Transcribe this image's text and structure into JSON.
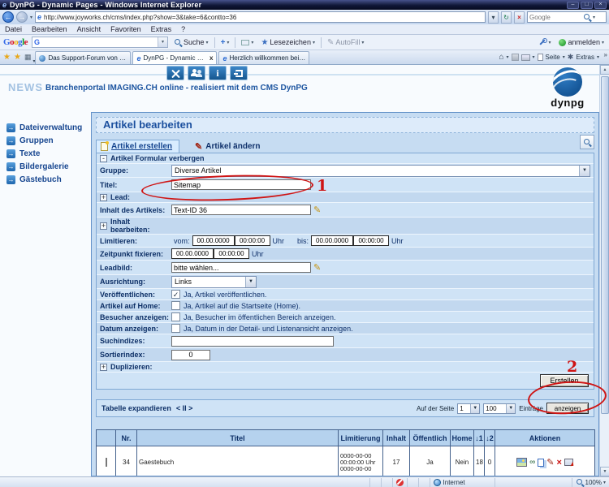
{
  "colors": {
    "accent_blue": "#1b5fa8",
    "panel_blue": "#c6dcf2",
    "link_navy": "#16458f",
    "annotation_red": "#cf1414",
    "brand_light_blue": "#a3c2e2",
    "table_header_blue": "#b5d2ee"
  },
  "icons": {
    "ie_logo": "e",
    "back": "←",
    "forward": "→",
    "refresh": "↻",
    "stop": "×",
    "dropdown": "▾",
    "select_arrow": "▼",
    "favorites_star": "★",
    "add_star": "★",
    "plus": "+",
    "quicktabs": "▦",
    "home": "⌂",
    "gear": "✱",
    "overflow": "»",
    "info": "i",
    "sidebar_arrow": "→",
    "collapse": "-",
    "expand": "+",
    "check": "✓",
    "pencil": "✎",
    "link": "∞",
    "delete": "×",
    "scroll_up": "▲",
    "scroll_down": "▼",
    "win_min": "–",
    "win_max": "□",
    "win_close": "×",
    "tab_close": "x"
  },
  "titlebar": {
    "title": "DynPG - Dynamic Pages - Windows Internet Explorer"
  },
  "addressbar": {
    "url": "http://www.joyworks.ch/cms/index.php?show=3&take=6&contto=36",
    "search_placeholder": "Google"
  },
  "menubar": {
    "items": [
      "Datei",
      "Bearbeiten",
      "Ansicht",
      "Favoriten",
      "Extras",
      "?"
    ]
  },
  "gtoolbar": {
    "logo": [
      {
        "ch": "G"
      },
      {
        "ch": "o"
      },
      {
        "ch": "o"
      },
      {
        "ch": "g"
      },
      {
        "ch": "l"
      },
      {
        "ch": "e"
      }
    ],
    "search_label": "Suche",
    "bookmarks_label": "Lesezeichen",
    "autofill_label": "AutoFill",
    "signin_label": "anmelden"
  },
  "ietabs": {
    "tabs": [
      {
        "label": "Das Support-Forum von DynPG"
      },
      {
        "label": "DynPG - Dynamic Pages"
      },
      {
        "label": "Herzlich willkommen bei Joyw..."
      }
    ],
    "seite_label": "Seite",
    "extras_label": "Extras"
  },
  "header": {
    "brand": "NEWS",
    "subtitle": "Branchenportal IMAGING.CH online - realisiert mit dem CMS DynPG",
    "logo_text": "dynpg"
  },
  "sidebar": {
    "items": [
      "Dateiverwaltung",
      "Gruppen",
      "Texte",
      "Bildergalerie",
      "Gästebuch"
    ]
  },
  "cms": {
    "page_title": "Artikel bearbeiten",
    "tab_create": "Artikel erstellen",
    "tab_edit": "Artikel ändern",
    "form": {
      "collapse_label": "Artikel Formular verbergen",
      "gruppe_label": "Gruppe:",
      "gruppe_value": "Diverse Artikel",
      "titel_label": "Titel:",
      "titel_value": "Sitemap",
      "lead_label": "Lead:",
      "inhalt_label": "Inhalt des Artikels:",
      "inhalt_value": "Text-ID 36",
      "inhalt_bearbeiten_label": "Inhalt bearbeiten:",
      "limitieren_label": "Limitieren:",
      "vom_label": "vom:",
      "bis_label": "bis:",
      "uhr_label": "Uhr",
      "date_zero": "00.00.0000",
      "time_zero": "00:00:00",
      "zeitpunkt_label": "Zeitpunkt fixieren:",
      "leadbild_label": "Leadbild:",
      "leadbild_value": "bitte wählen...",
      "ausrichtung_label": "Ausrichtung:",
      "ausrichtung_value": "Links",
      "veroeffentlichen_label": "Veröffentlichen:",
      "veroeffentlichen_text": "Ja, Artikel veröffentlichen.",
      "home_label": "Artikel auf Home:",
      "home_text": "Ja, Artikel auf die Startseite (Home).",
      "besucher_label": "Besucher anzeigen:",
      "besucher_text": "Ja, Besucher im öffentlichen Bereich anzeigen.",
      "datum_label": "Datum anzeigen:",
      "datum_text": "Ja, Datum in der Detail- und Listenansicht anzeigen.",
      "suchindizes_label": "Suchindizes:",
      "suchindizes_value": "",
      "sortierindex_label": "Sortierindex:",
      "sortierindex_value": "0",
      "duplizieren_label": "Duplizieren:",
      "submit_label": "Erstellen"
    },
    "annotations": {
      "n1": "1",
      "n2": "2"
    },
    "table": {
      "expand_label": "Tabelle expandieren",
      "expand_pager": "< II >",
      "page_label": "Auf der Seite",
      "page_value": "1",
      "count_value": "100",
      "entries_label": "Einträge",
      "show_label": "anzeigen",
      "headers": [
        "",
        "Nr.",
        "Titel",
        "Limitierung",
        "Inhalt",
        "Öffentlich",
        "Home",
        "↓1",
        "↓2",
        "Aktionen"
      ],
      "row": {
        "nr": "34",
        "titel": "Gaestebuch",
        "lim1": "0000-00-00",
        "lim2": "00:00:00 Uhr",
        "lim3": "0000-00-00",
        "inhalt": "17",
        "oeffentlich": "Ja",
        "home": "Nein",
        "sort1": "18",
        "sort2": "0"
      }
    }
  },
  "statusbar": {
    "zone_label": "Internet",
    "zoom_label": "100%"
  }
}
